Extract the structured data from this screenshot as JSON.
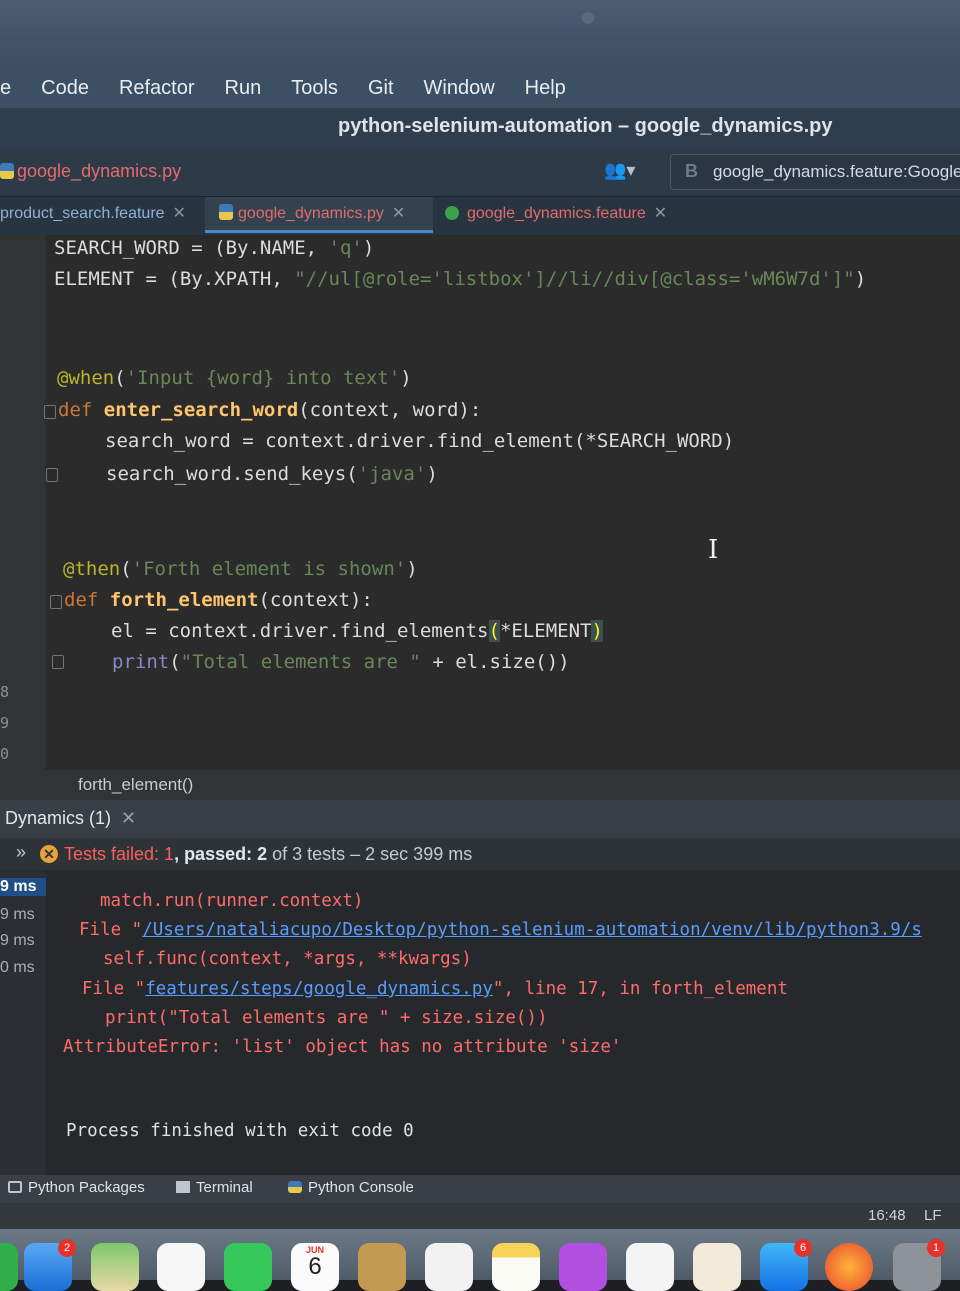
{
  "menu": [
    "e",
    "Code",
    "Refactor",
    "Run",
    "Tools",
    "Git",
    "Window",
    "Help"
  ],
  "title": "python-selenium-automation – google_dynamics.py",
  "nav": {
    "file": "google_dynamics.py",
    "run_config": "google_dynamics.feature:Google"
  },
  "tabs": [
    {
      "label": "product_search.feature"
    },
    {
      "label": "google_dynamics.py"
    },
    {
      "label": "google_dynamics.feature"
    }
  ],
  "editor": {
    "line_numbers": [
      "8",
      "9",
      "0"
    ],
    "lines": {
      "l1_a": "SEARCH_WORD = (By.NAME, ",
      "l1_b": "'q'",
      "l1_c": ")",
      "l2_a": "ELEMENT = (By.XPATH, ",
      "l2_b": "\"//ul[@role='listbox']//li//div[@class='wM6W7d']\"",
      "l2_c": ")",
      "l3_dec": "@when",
      "l3_a": "(",
      "l3_str": "'Input {word} into text'",
      "l3_b": ")",
      "l4_kw": "def ",
      "l4_fn": "enter_search_word",
      "l4_a": "(context, word):",
      "l5": "search_word = context.driver.find_element(*SEARCH_WORD)",
      "l6_a": "search_word.send_keys(",
      "l6_str": "'java'",
      "l6_b": ")",
      "l7_dec": "@then",
      "l7_a": "(",
      "l7_str": "'Forth element is shown'",
      "l7_b": ")",
      "l8_kw": "def ",
      "l8_fn": "forth_element",
      "l8_a": "(context):",
      "l9_a": "el = context.driver.find_elements",
      "l9_h1": "(",
      "l9_b": "*ELEMENT",
      "l9_h2": ")",
      "l10_bi": "print",
      "l10_a": "(",
      "l10_str": "\"Total elements are \"",
      "l10_b": " + el.size())"
    },
    "breadcrumb": "forth_element()"
  },
  "run_panel": {
    "tab": "Dynamics (1)",
    "status": {
      "failed_label": "Tests failed: ",
      "failed_count": "1",
      "passed_label": ", passed: ",
      "passed_count": "2",
      "tail": " of 3 tests – 2 sec 399 ms"
    },
    "durations": [
      "9 ms",
      "9 ms",
      "9 ms",
      "0 ms"
    ],
    "console": {
      "c1": "match.run(runner.context)",
      "c2_a": "File \"",
      "c2_link": "/Users/nataliacupo/Desktop/python-selenium-automation/venv/lib/python3.9/s",
      "c3": "self.func(context, *args, **kwargs)",
      "c4_a": "File \"",
      "c4_link": "features/steps/google_dynamics.py",
      "c4_b": "\", line 17, in forth_element",
      "c5": "print(\"Total elements are \" + size.size())",
      "c6": "AttributeError: 'list' object has no attribute 'size'",
      "c7": "Process finished with exit code 0"
    }
  },
  "tool_tabs": [
    "Python Packages",
    "Terminal",
    "Python Console"
  ],
  "status_bar": {
    "time": "16:48",
    "line_sep": "LF"
  },
  "dock": {
    "mail_badge": "2",
    "calendar_month": "JUN",
    "calendar_day": "6",
    "appstore_badge": "6",
    "settings_badge": "1"
  }
}
